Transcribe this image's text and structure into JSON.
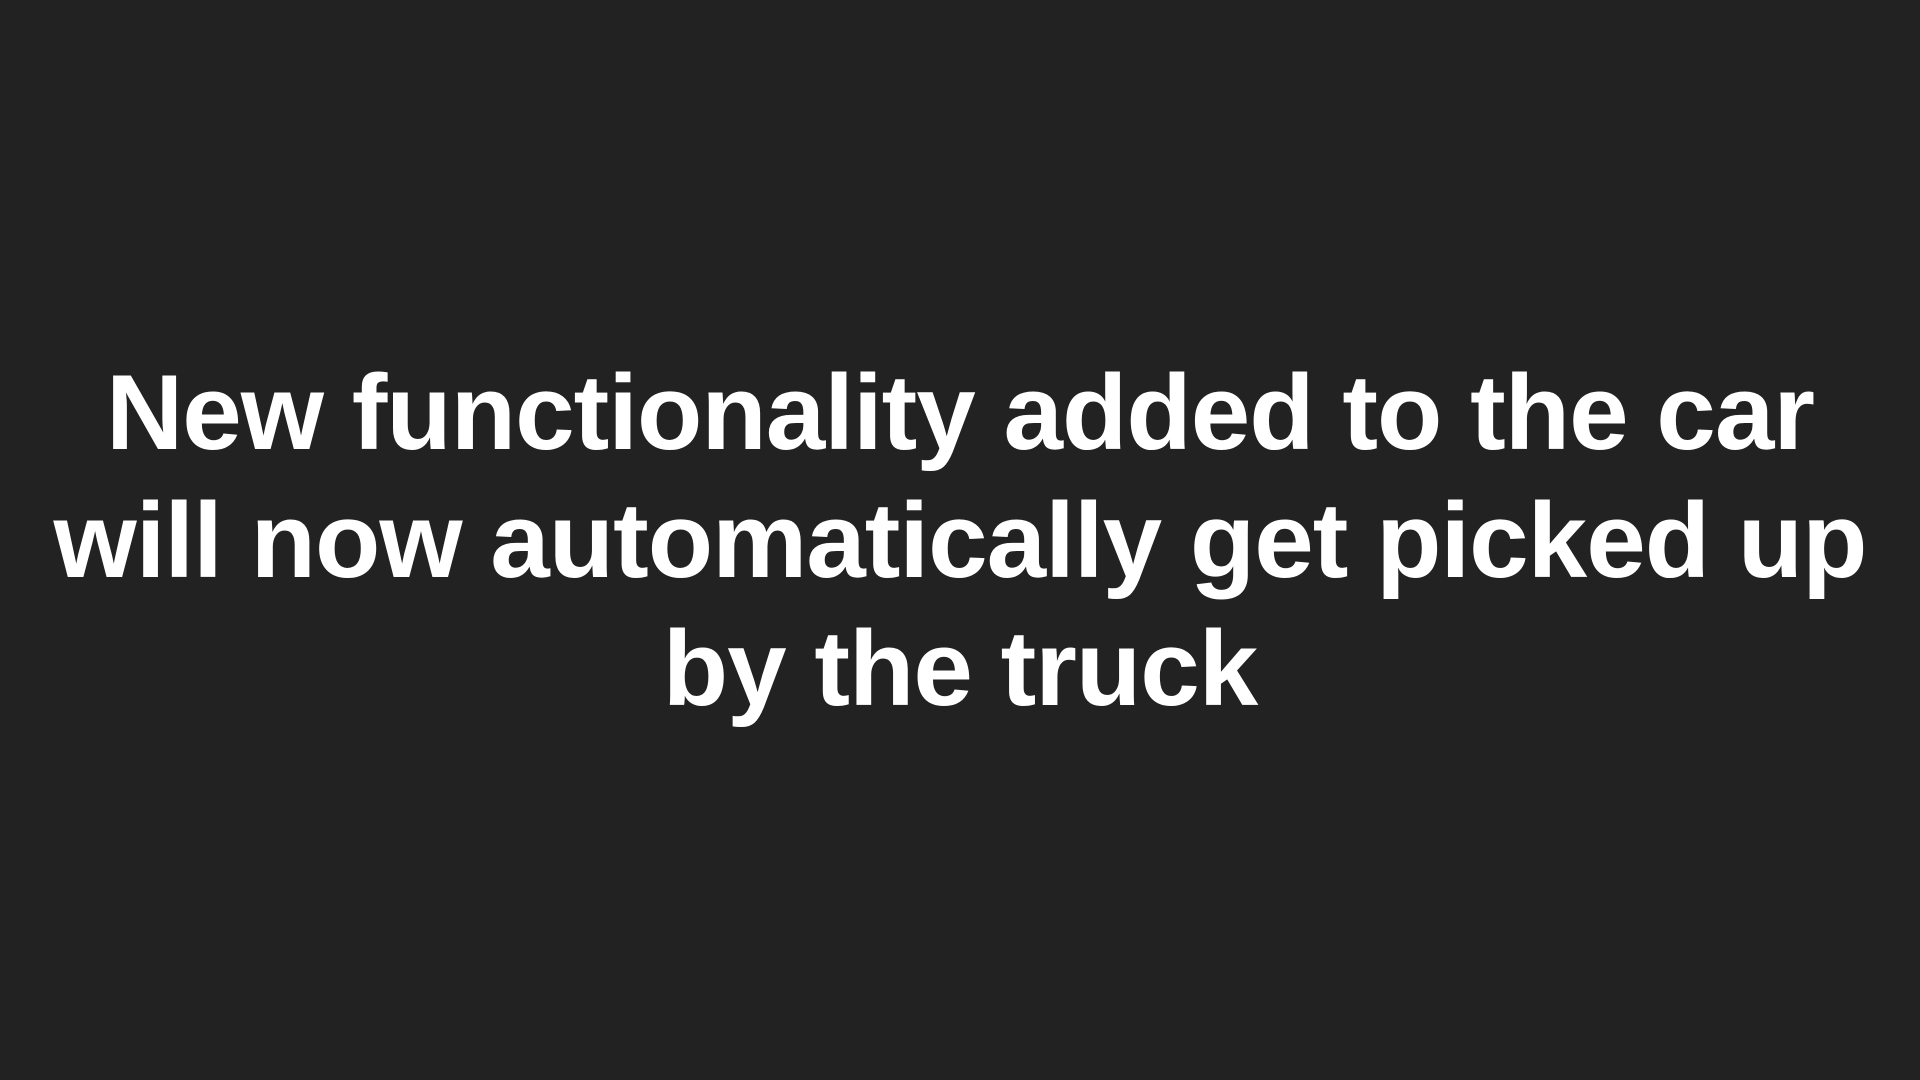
{
  "slide": {
    "background_color": "#222222",
    "text_color": "#ffffff",
    "lines": [
      "New functionality added to the car",
      "will now automatically get picked up",
      "by the truck"
    ]
  }
}
